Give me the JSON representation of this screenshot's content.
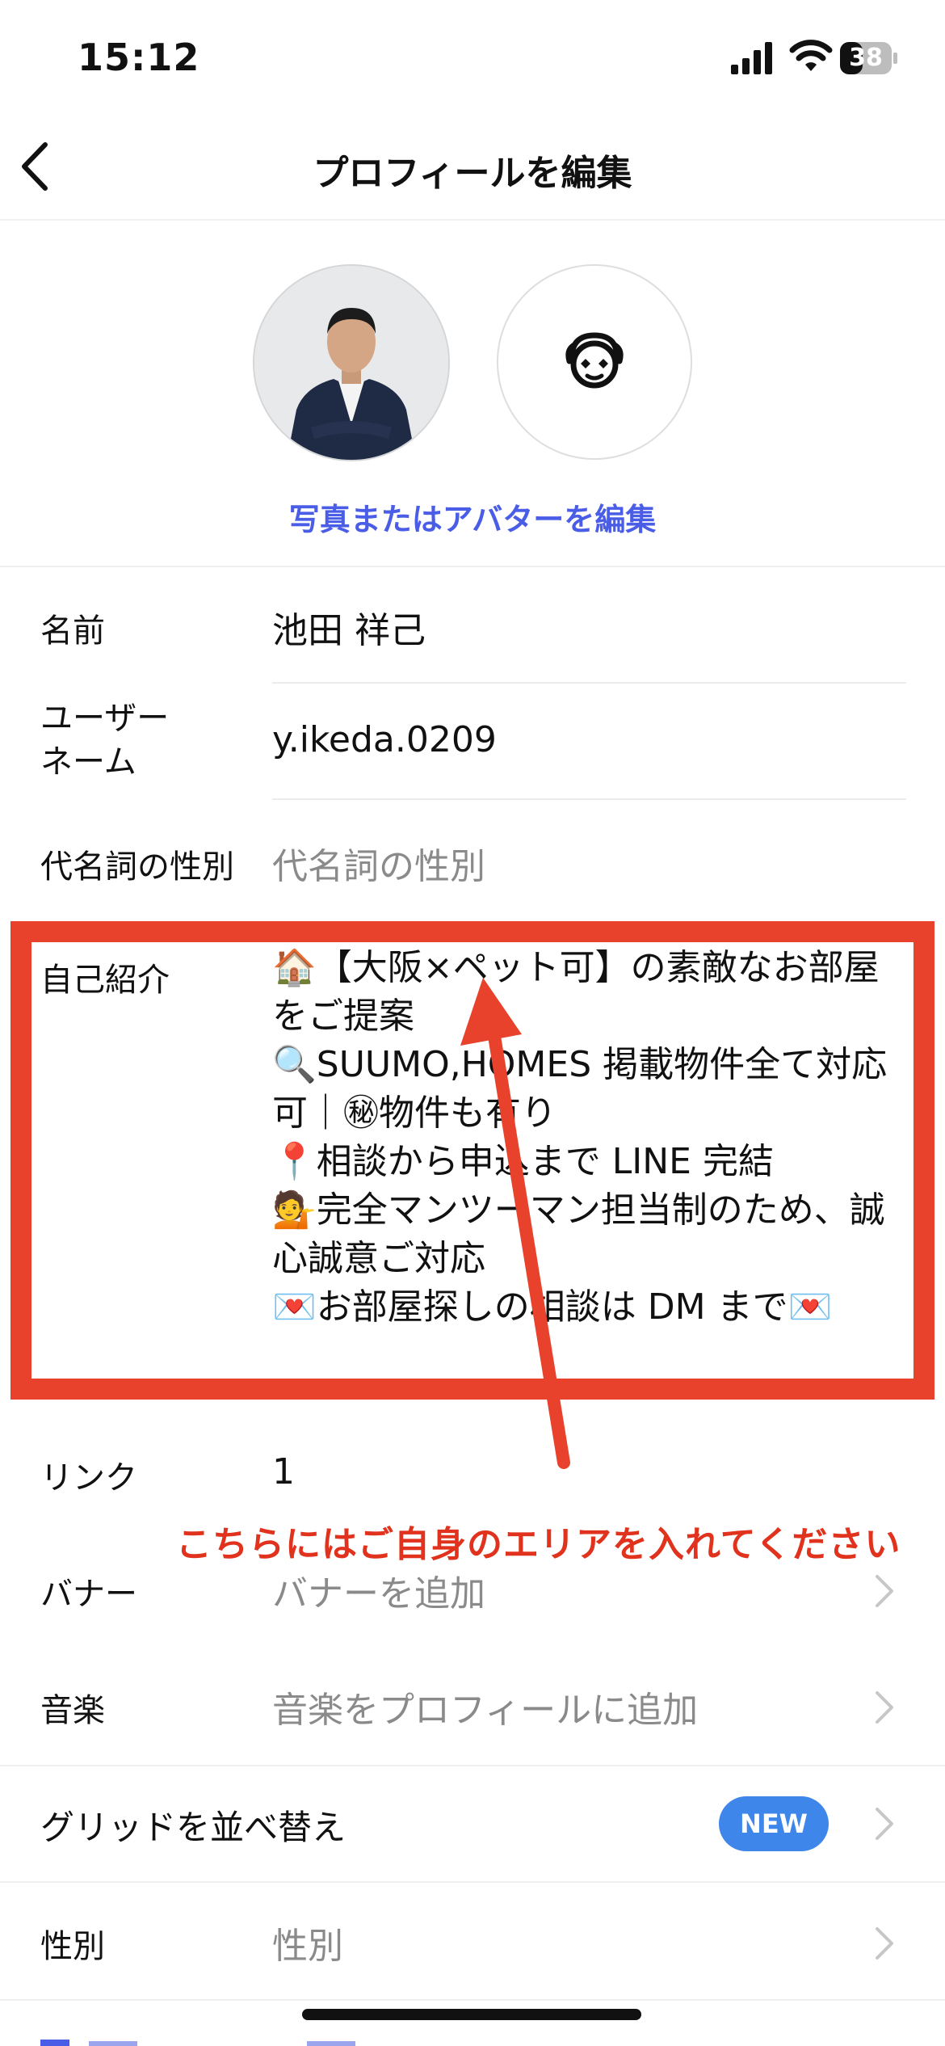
{
  "status_bar": {
    "time": "15:12",
    "battery": "38"
  },
  "nav": {
    "title": "プロフィールを編集"
  },
  "photos": {
    "edit_label": "写真またはアバターを編集"
  },
  "fields": {
    "name": {
      "label": "名前",
      "value": "池田 祥己"
    },
    "username": {
      "label_line1": "ユーザー",
      "label_line2": "ネーム",
      "value": "y.ikeda.0209"
    },
    "pronouns": {
      "label": "代名詞の性別",
      "placeholder": "代名詞の性別"
    },
    "bio": {
      "label": "自己紹介",
      "value": "🏠【大阪×ペット可】の素敵なお部屋をご提案\n🔍SUUMO,HOMES 掲載物件全て対応可｜㊙物件も有り\n📍相談から申込まで LINE 完結\n💁完全マンツーマン担当制のため、誠心誠意ご対応\n💌お部屋探しの相談は DM まで💌"
    },
    "links": {
      "label": "リンク",
      "value": "1"
    },
    "banner": {
      "label": "バナー",
      "placeholder": "バナーを追加"
    },
    "music": {
      "label": "音楽",
      "placeholder": "音楽をプロフィールに追加"
    },
    "grid": {
      "label": "グリッドを並べ替え",
      "badge": "NEW"
    },
    "gender": {
      "label": "性別",
      "placeholder": "性別"
    }
  },
  "annotation": {
    "text": "こちらにはご自身のエリアを入れてください"
  },
  "colors": {
    "accent_blue": "#4a5de6",
    "annotation_red": "#e8422c",
    "badge_blue": "#3f86ea"
  }
}
